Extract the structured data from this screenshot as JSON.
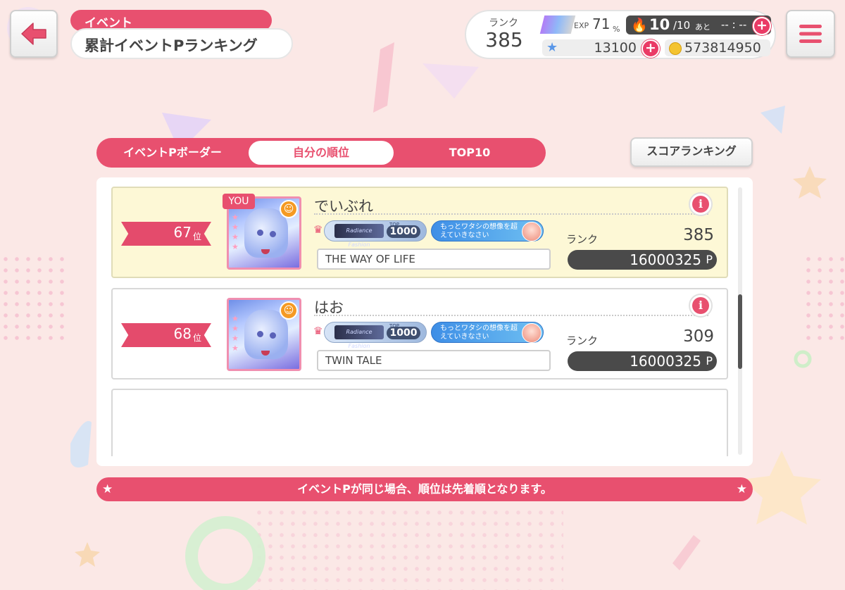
{
  "header": {
    "crumb": "イベント",
    "title": "累計イベントPランキング",
    "back_icon": "arrow-left-icon",
    "menu_icon": "hamburger-icon"
  },
  "status": {
    "rank_label": "ランク",
    "rank_value": "385",
    "exp_label": "EXP",
    "exp_value": "71",
    "exp_unit": "%",
    "exp_percent": 71,
    "stamina_current": "10",
    "stamina_max": "/10",
    "stamina_after": "あと",
    "stamina_time": "-- : --",
    "stars": "13100",
    "coins": "573814950"
  },
  "tabs": {
    "items": [
      "イベントPボーダー",
      "自分の順位",
      "TOP10"
    ],
    "active": "自分の順位",
    "score_ranking": "スコアランキング"
  },
  "rows": [
    {
      "rank": "67",
      "rank_suffix": "位",
      "is_me": true,
      "you_label": "YOU",
      "name": "でいぶれ",
      "title_top": "TOP",
      "title_rank": "1000",
      "title_logo": "Radiance Fashion",
      "song_title": "もっとワタシの想像を超えていきなさい",
      "comment": "THE WAY OF LIFE",
      "rank_label": "ランク",
      "player_rank": "385",
      "points": "16000325",
      "points_unit": "P"
    },
    {
      "rank": "68",
      "rank_suffix": "位",
      "is_me": false,
      "name": "はお",
      "title_top": "TOP",
      "title_rank": "1000",
      "title_logo": "Radiance Fashion",
      "song_title": "もっとワタシの想像を超えていきなさい",
      "comment": "TWIN TALE",
      "rank_label": "ランク",
      "player_rank": "309",
      "points": "16000325",
      "points_unit": "P"
    }
  ],
  "notice": "イベントPが同じ場合、順位は先着順となります。",
  "colors": {
    "accent": "#e8506f",
    "background": "#fbe8e6",
    "highlight_row": "#fdf8d6"
  }
}
